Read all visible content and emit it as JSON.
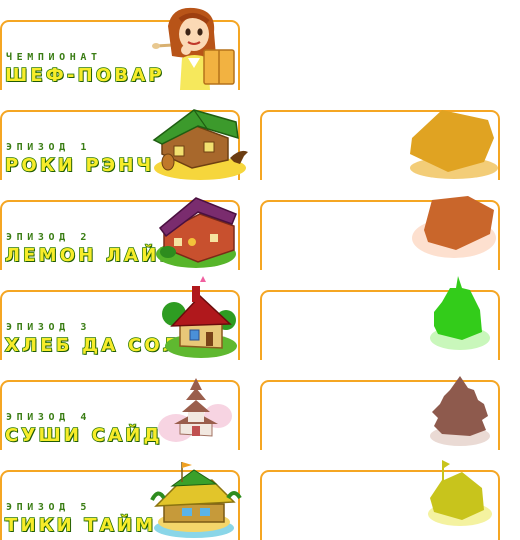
{
  "championship": {
    "subtitle": "ЧЕМПИОНАТ",
    "title": "ШЕФ-ПОВАР"
  },
  "episodes": [
    {
      "subtitle": "ЭПИЗОД 1",
      "title": "РОКИ РЭНЧ",
      "locked_color": "#e0a322"
    },
    {
      "subtitle": "ЭПИЗОД 2",
      "title": "ЛЕМОН ЛАЙМ",
      "locked_color": "#c9662b"
    },
    {
      "subtitle": "ЭПИЗОД 3",
      "title": "ХЛЕБ ДА СОЛЬ",
      "locked_color": "#33cc1a"
    },
    {
      "subtitle": "ЭПИЗОД 4",
      "title": "СУШИ САЙД",
      "locked_color": "#8e5a4d"
    },
    {
      "subtitle": "ЭПИЗОД 5",
      "title": "ТИКИ ТАЙМ",
      "locked_color": "#c8c41c"
    }
  ],
  "colors": {
    "card_border": "#f5a623",
    "title_fill": "#f7ec2a",
    "title_outline": "#2c7b08",
    "subtitle": "#3a7d14"
  },
  "icons": {
    "chef": "chef-girl-icon",
    "ep1": "ranch-house-icon",
    "ep2": "lemon-lime-house-icon",
    "ep3": "bread-salt-house-icon",
    "ep4": "pagoda-icon",
    "ep5": "tiki-hut-icon"
  }
}
